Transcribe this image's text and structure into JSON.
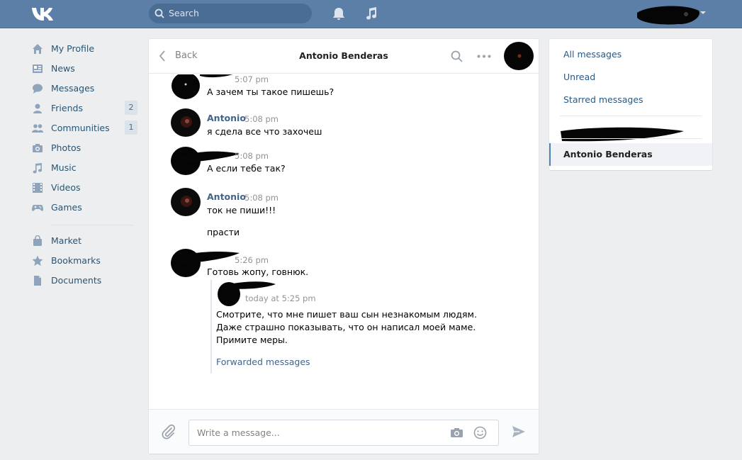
{
  "topbar": {
    "search_placeholder": "Search"
  },
  "nav": {
    "items": [
      {
        "label": "My Profile",
        "icon": "home-icon"
      },
      {
        "label": "News",
        "icon": "news-icon"
      },
      {
        "label": "Messages",
        "icon": "messages-icon"
      },
      {
        "label": "Friends",
        "icon": "friends-icon",
        "count": "2"
      },
      {
        "label": "Communities",
        "icon": "communities-icon",
        "count": "1"
      },
      {
        "label": "Photos",
        "icon": "camera-icon"
      },
      {
        "label": "Music",
        "icon": "music-icon"
      },
      {
        "label": "Videos",
        "icon": "film-icon"
      },
      {
        "label": "Games",
        "icon": "gamepad-icon"
      }
    ],
    "items2": [
      {
        "label": "Market",
        "icon": "bag-icon"
      },
      {
        "label": "Bookmarks",
        "icon": "star-icon"
      },
      {
        "label": "Documents",
        "icon": "document-icon"
      }
    ]
  },
  "chat": {
    "back": "Back",
    "title": "Antonio Benderas",
    "messages": [
      {
        "name": "",
        "time": "5:07 pm",
        "lines": [
          "А зачем ты такое пишешь?"
        ]
      },
      {
        "name": "Antonio",
        "time": "5:08 pm",
        "lines": [
          "я сдела все что захочеш"
        ]
      },
      {
        "name": "",
        "time": "5:08 pm",
        "lines": [
          "А если тебе так?"
        ]
      },
      {
        "name": "Antonio",
        "time": "5:08 pm",
        "lines": [
          "ток не пиши!!!",
          "прасти"
        ]
      },
      {
        "name": "",
        "time": "5:26 pm",
        "lines": [
          "Готовь жопу, говнюк."
        ]
      }
    ],
    "forwarded": {
      "time": "today at 5:25 pm",
      "lines": [
        "Смотрите, что мне пишет ваш сын незнакомым людям.",
        "Даже страшно показывать, что он написал моей маме.",
        "Примите меры."
      ],
      "link": "Forwarded messages"
    },
    "input_placeholder": "Write a message..."
  },
  "right": {
    "all": "All messages",
    "unread": "Unread",
    "starred": "Starred messages",
    "active": "Antonio Benderas"
  },
  "colors": {
    "header": "#5b7fa6",
    "link": "#2a5885",
    "name": "#42648b"
  }
}
